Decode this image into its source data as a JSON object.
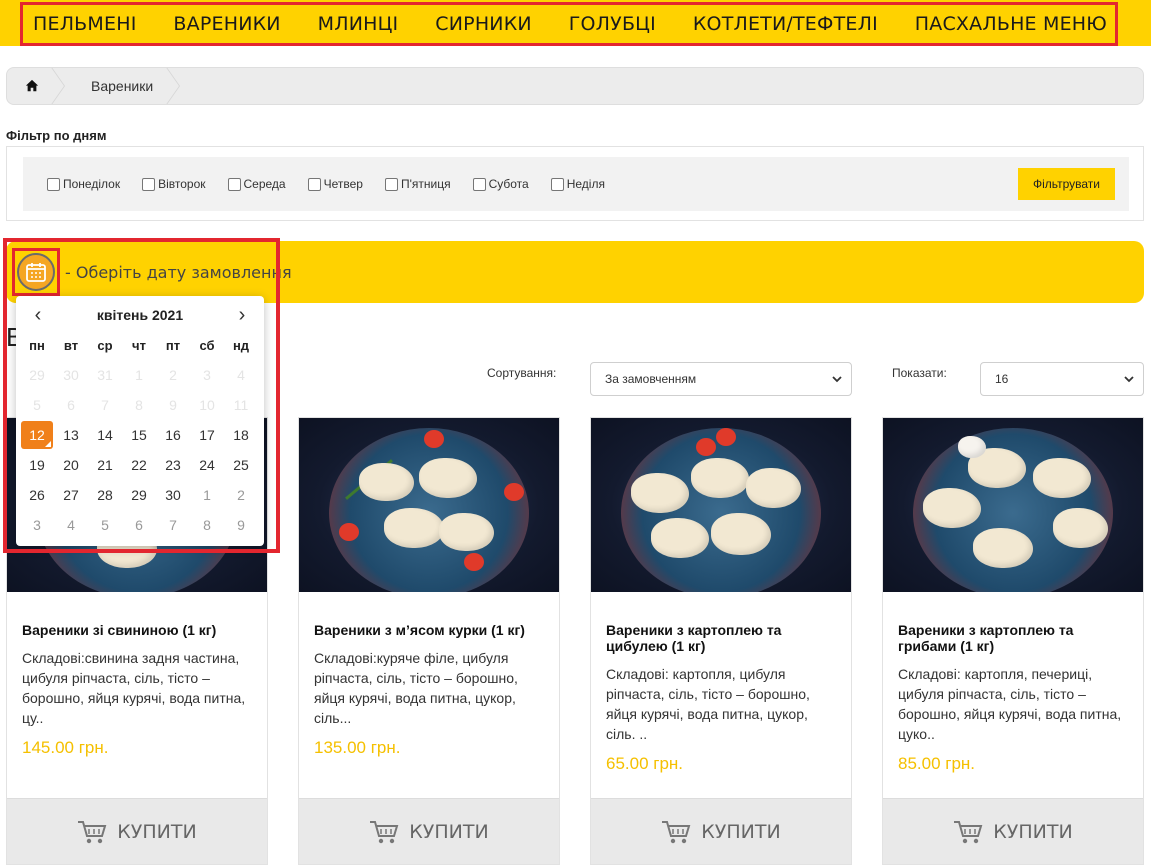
{
  "nav": [
    "ПЕЛЬМЕНІ",
    "ВАРЕНИКИ",
    "МЛИНЦІ",
    "СИРНИКИ",
    "ГОЛУБЦІ",
    "КОТЛЕТИ/ТЕФТЕЛІ",
    "ПАСХАЛЬНЕ МЕНЮ"
  ],
  "breadcrumb": {
    "home_icon": "home-icon",
    "current": "Вареники"
  },
  "filter": {
    "title": "Фільтр по дням",
    "days": [
      "Понеділок",
      "Вівторок",
      "Середа",
      "Четвер",
      "П'ятниця",
      "Субота",
      "Неділя"
    ],
    "button": "Фільтрувати"
  },
  "date_bar": {
    "label": "- Оберіть дату замовлення",
    "icon": "calendar-icon"
  },
  "calendar": {
    "prev": "‹",
    "next": "›",
    "month": "квітень 2021",
    "weekdays": [
      "пн",
      "вт",
      "ср",
      "чт",
      "пт",
      "сб",
      "нд"
    ],
    "selected_day": "12"
  },
  "page_heading": "В",
  "sort": {
    "label": "Сортування:",
    "value": "За замовченням"
  },
  "show": {
    "label": "Показати:",
    "value": "16"
  },
  "products": [
    {
      "title": "Вареники зі свининою (1 кг)",
      "desc": "Складові:свинина задня частина, цибуля ріпчаста, сіль, тісто – борошно, яйця курячі, вода питна, цу..",
      "price": "145.00 грн.",
      "buy": "КУПИТИ"
    },
    {
      "title": "Вареники з м’ясом курки (1 кг)",
      "desc": "Складові:куряче філе, цибуля ріпчаста, сіль, тісто – борошно, яйця курячі, вода питна, цукор, сіль...",
      "price": "135.00 грн.",
      "buy": "КУПИТИ"
    },
    {
      "title": "Вареники з картоплею та цибулею (1 кг)",
      "desc": "Складові: картопля, цибуля ріпчаста, сіль, тісто – борошно, яйця курячі, вода питна, цукор, сіль. ..",
      "price": "65.00 грн.",
      "buy": "КУПИТИ"
    },
    {
      "title": "Вареники з картоплею та грибами (1 кг)",
      "desc": "Складові: картопля, печериці, цибуля ріпчаста, сіль, тісто – борошно, яйця курячі, вода питна, цуко..",
      "price": "85.00 грн.",
      "buy": "КУПИТИ"
    }
  ],
  "colors": {
    "accent": "#ffd200",
    "highlight": "#e3262f",
    "price": "#f5c000",
    "today": "#f0801a"
  }
}
